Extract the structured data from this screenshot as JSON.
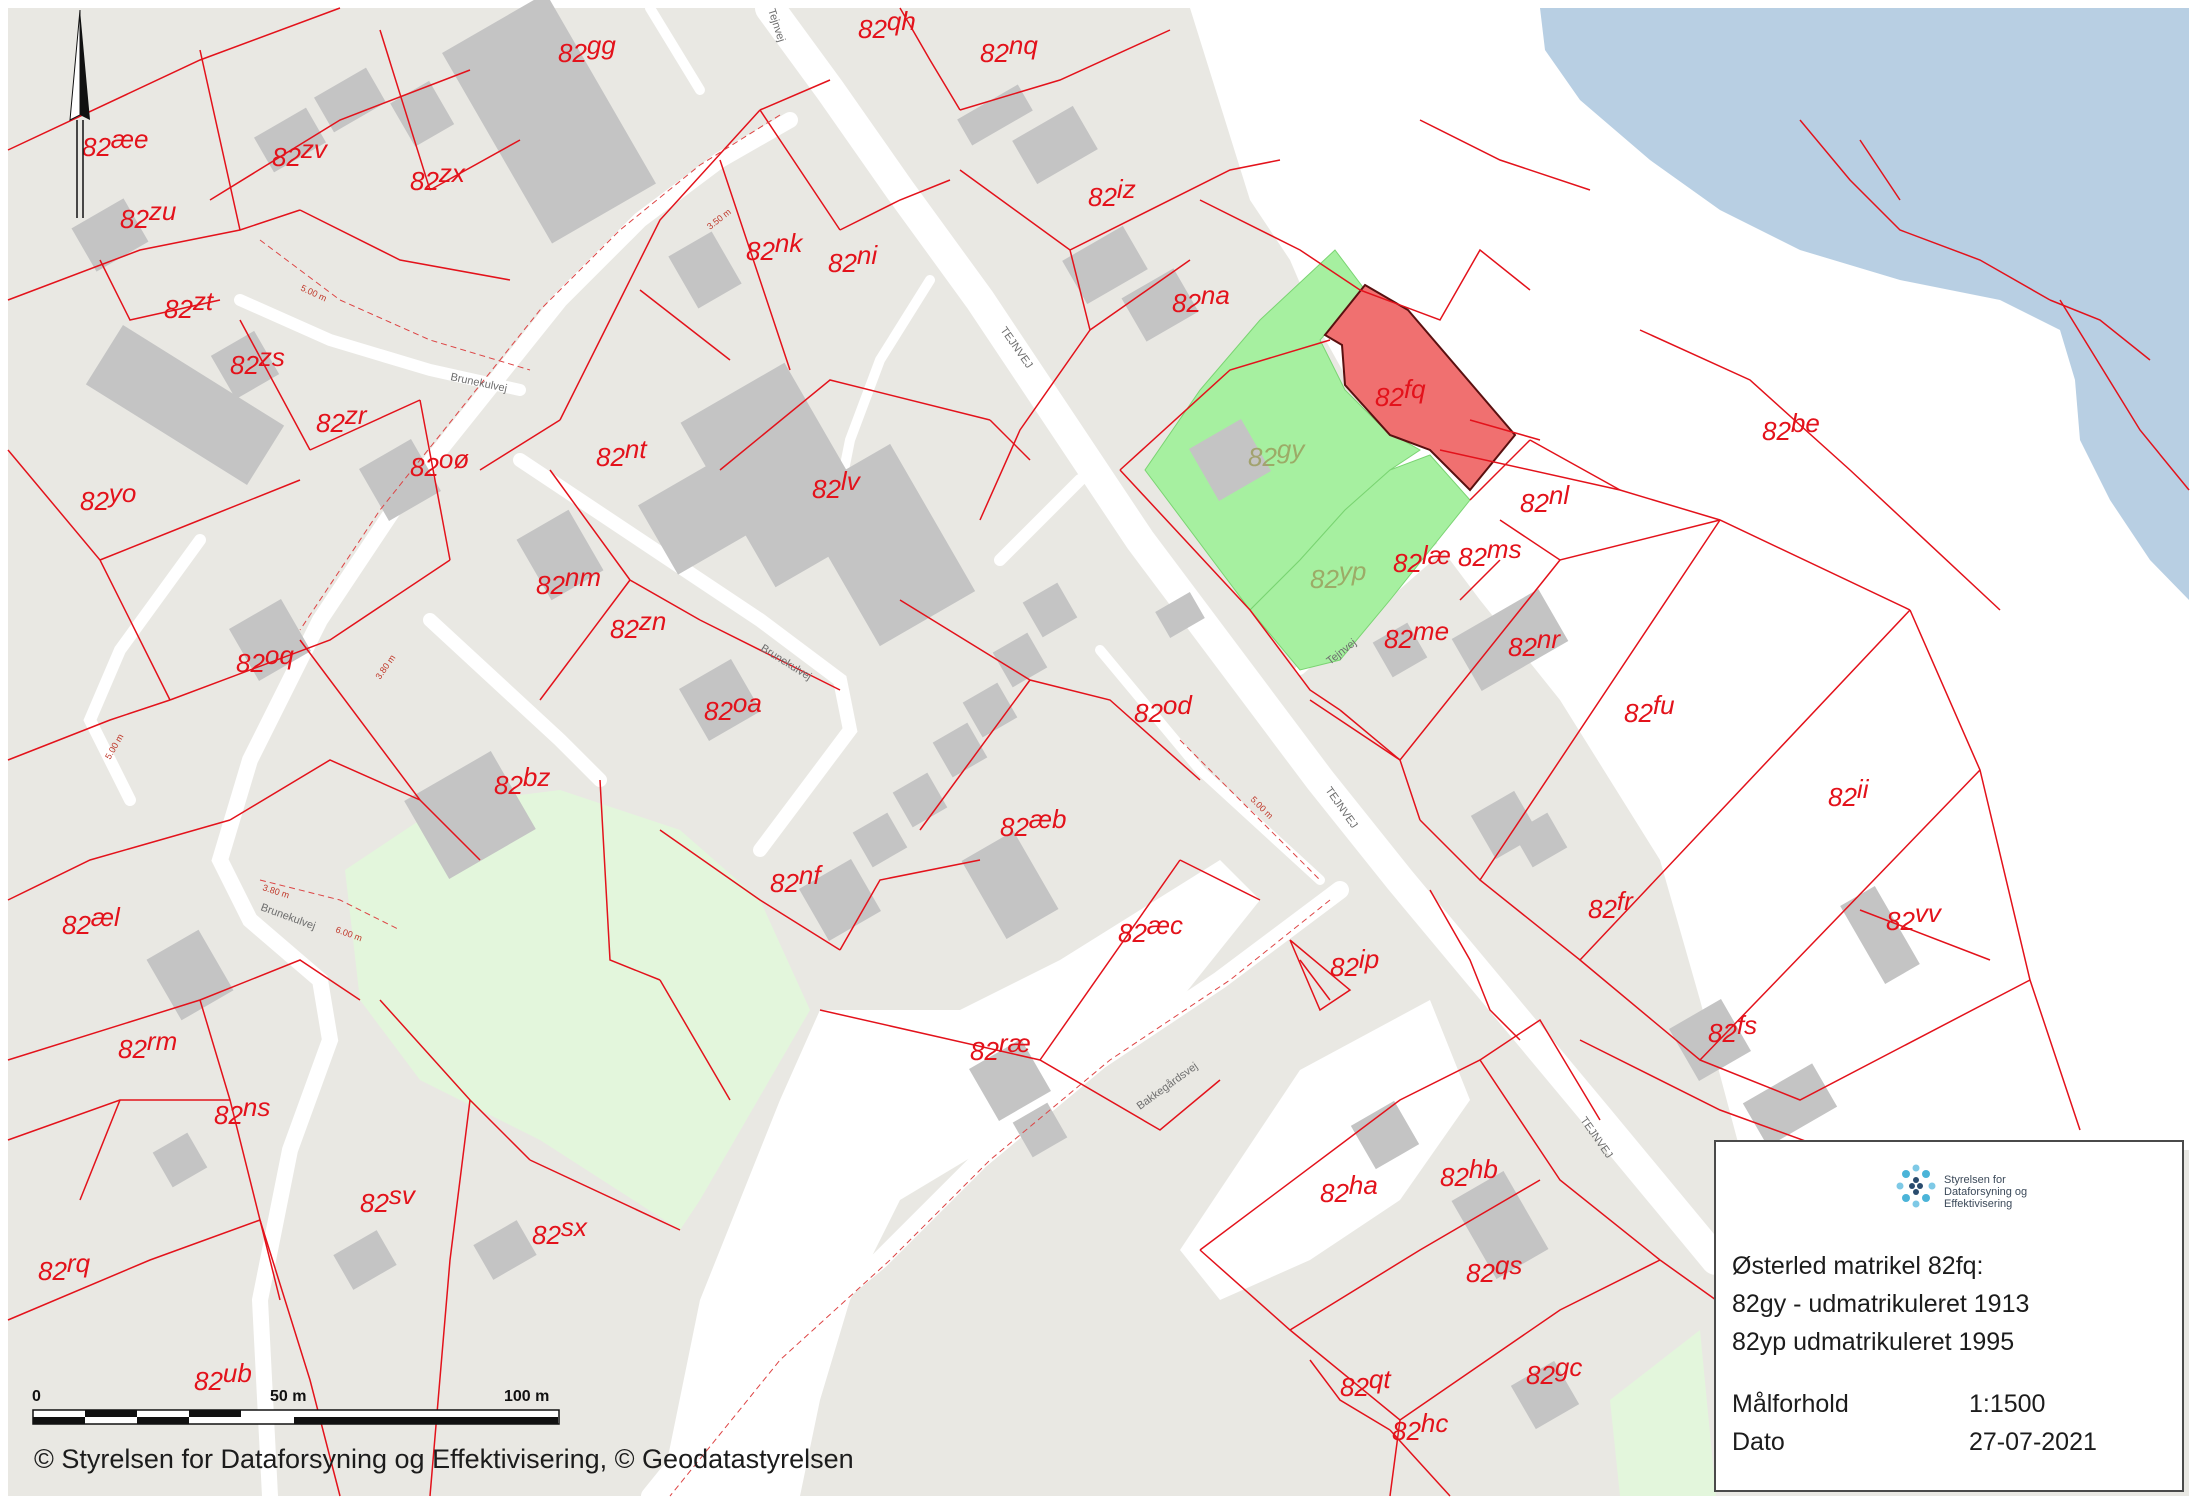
{
  "map": {
    "title": "Østerled matrikel 82fq",
    "colors": {
      "background": "#e9e8e3",
      "water": "#b8cfe3",
      "buildings": "#c4c4c4",
      "boundaries": "#e3121b",
      "highlight_red": "#f07070",
      "highlight_green": "#a6f0a0",
      "open_area": "#ffffff",
      "light_green": "#e3f6dc"
    },
    "parcels": [
      {
        "id": "82qh",
        "num": "82",
        "suffix": "qh"
      },
      {
        "id": "82nq",
        "num": "82",
        "suffix": "nq"
      },
      {
        "id": "82gg",
        "num": "82",
        "suffix": "gg"
      },
      {
        "id": "82aee",
        "num": "82",
        "suffix": "æe"
      },
      {
        "id": "82zv",
        "num": "82",
        "suffix": "zv"
      },
      {
        "id": "82zx",
        "num": "82",
        "suffix": "zx"
      },
      {
        "id": "82iz",
        "num": "82",
        "suffix": "iz"
      },
      {
        "id": "82zu",
        "num": "82",
        "suffix": "zu"
      },
      {
        "id": "82nk",
        "num": "82",
        "suffix": "nk"
      },
      {
        "id": "82ni",
        "num": "82",
        "suffix": "ni"
      },
      {
        "id": "82zt",
        "num": "82",
        "suffix": "zt"
      },
      {
        "id": "82na",
        "num": "82",
        "suffix": "na"
      },
      {
        "id": "82zs",
        "num": "82",
        "suffix": "zs"
      },
      {
        "id": "82fq",
        "num": "82",
        "suffix": "fq"
      },
      {
        "id": "82be",
        "num": "82",
        "suffix": "be"
      },
      {
        "id": "82zr",
        "num": "82",
        "suffix": "zr"
      },
      {
        "id": "82nt",
        "num": "82",
        "suffix": "nt"
      },
      {
        "id": "82gy",
        "num": "82",
        "suffix": "gy"
      },
      {
        "id": "82oo",
        "num": "82",
        "suffix": "oø"
      },
      {
        "id": "82lv",
        "num": "82",
        "suffix": "lv"
      },
      {
        "id": "82yo",
        "num": "82",
        "suffix": "yo"
      },
      {
        "id": "82nl",
        "num": "82",
        "suffix": "nl"
      },
      {
        "id": "82yp",
        "num": "82",
        "suffix": "yp"
      },
      {
        "id": "82lae",
        "num": "82",
        "suffix": "læ"
      },
      {
        "id": "82ms",
        "num": "82",
        "suffix": "ms"
      },
      {
        "id": "82nm",
        "num": "82",
        "suffix": "nm"
      },
      {
        "id": "82zn",
        "num": "82",
        "suffix": "zn"
      },
      {
        "id": "82me",
        "num": "82",
        "suffix": "me"
      },
      {
        "id": "82nr",
        "num": "82",
        "suffix": "nr"
      },
      {
        "id": "82oq",
        "num": "82",
        "suffix": "oq"
      },
      {
        "id": "82oa",
        "num": "82",
        "suffix": "oa"
      },
      {
        "id": "82od",
        "num": "82",
        "suffix": "od"
      },
      {
        "id": "82fu",
        "num": "82",
        "suffix": "fu"
      },
      {
        "id": "82bz",
        "num": "82",
        "suffix": "bz"
      },
      {
        "id": "82ii",
        "num": "82",
        "suffix": "ii"
      },
      {
        "id": "82aeb",
        "num": "82",
        "suffix": "æb"
      },
      {
        "id": "82nf",
        "num": "82",
        "suffix": "nf"
      },
      {
        "id": "82fr",
        "num": "82",
        "suffix": "fr"
      },
      {
        "id": "82ael",
        "num": "82",
        "suffix": "æl"
      },
      {
        "id": "82aec",
        "num": "82",
        "suffix": "æc"
      },
      {
        "id": "82vv",
        "num": "82",
        "suffix": "vv"
      },
      {
        "id": "82ip",
        "num": "82",
        "suffix": "ip"
      },
      {
        "id": "82rm",
        "num": "82",
        "suffix": "rm"
      },
      {
        "id": "82rae",
        "num": "82",
        "suffix": "ræ"
      },
      {
        "id": "82fs",
        "num": "82",
        "suffix": "fs"
      },
      {
        "id": "82ns",
        "num": "82",
        "suffix": "ns"
      },
      {
        "id": "82ha",
        "num": "82",
        "suffix": "ha"
      },
      {
        "id": "82hb",
        "num": "82",
        "suffix": "hb"
      },
      {
        "id": "82sv",
        "num": "82",
        "suffix": "sv"
      },
      {
        "id": "82sx",
        "num": "82",
        "suffix": "sx"
      },
      {
        "id": "82qs",
        "num": "82",
        "suffix": "qs"
      },
      {
        "id": "82rq",
        "num": "82",
        "suffix": "rq"
      },
      {
        "id": "82ub",
        "num": "82",
        "suffix": "ub"
      },
      {
        "id": "82qt",
        "num": "82",
        "suffix": "qt"
      },
      {
        "id": "82gc",
        "num": "82",
        "suffix": "gc"
      },
      {
        "id": "82hc",
        "num": "82",
        "suffix": "hc"
      }
    ],
    "road_labels": {
      "tejnvej_1": "TEJNVEJ",
      "tejnvej_2": "TEJNVEJ",
      "tejnvej_3": "TEJNVEJ",
      "tejnvej_4": "Tejnvej",
      "brunekulvej_1": "Brunekulvej",
      "brunekulvej_2": "Brunekulvej",
      "brunekulvej_3": "Brunekulvej",
      "bakkegaardsvej": "Bakkegårdsvej",
      "tejnvej_top": "Tejnvej"
    },
    "dimension_labels": {
      "d1": "3.50 m",
      "d2": "5.00 m",
      "d3": "3.80 m",
      "d4": "5.00 m",
      "d5": "3.80 m",
      "d6": "6.00 m",
      "d7": "5.00 m"
    }
  },
  "scalebar": {
    "ticks": [
      "0",
      "50 m",
      "100 m"
    ]
  },
  "copyright": "© Styrelsen for Dataforsyning og Effektivisering, © Geodatastyrelsen",
  "legend": {
    "logo_org_line1": "Styrelsen for",
    "logo_org_line2": "Dataforsyning og",
    "logo_org_line3": "Effektivisering",
    "title": "Østerled matrikel 82fq:",
    "line1": "82gy - udmatrikuleret 1913",
    "line2": "82yp udmatrikuleret 1995",
    "scale_label": "Målforhold",
    "scale_value": "1:1500",
    "date_label": "Dato",
    "date_value": "27-07-2021"
  }
}
